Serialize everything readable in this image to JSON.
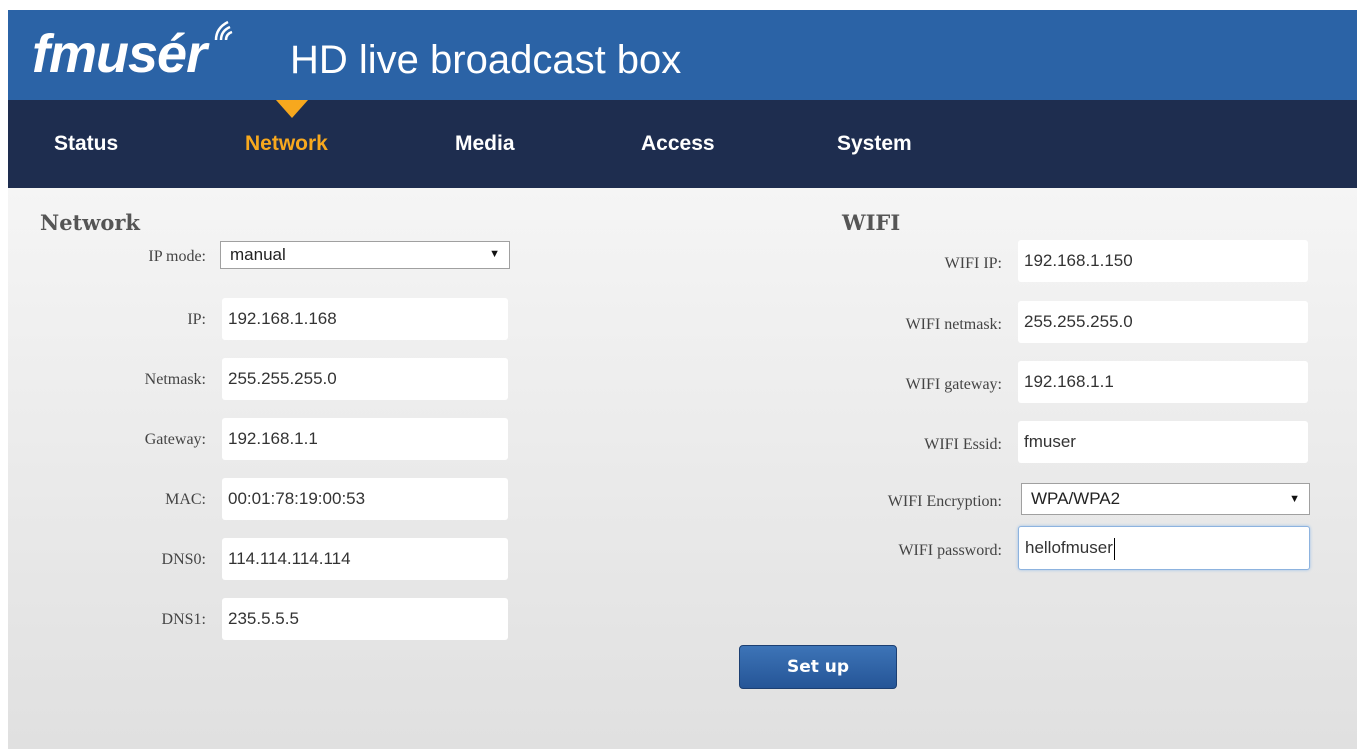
{
  "header": {
    "logo_text": "fmusér",
    "product_title": "HD live broadcast box"
  },
  "nav": {
    "items": [
      {
        "label": "Status"
      },
      {
        "label": "Network",
        "active": true
      },
      {
        "label": "Media"
      },
      {
        "label": "Access"
      },
      {
        "label": "System"
      }
    ]
  },
  "network": {
    "title": "Network",
    "ip_mode": {
      "label": "IP mode:",
      "value": "manual"
    },
    "ip": {
      "label": "IP:",
      "value": "192.168.1.168"
    },
    "netmask": {
      "label": "Netmask:",
      "value": "255.255.255.0"
    },
    "gateway": {
      "label": "Gateway:",
      "value": "192.168.1.1"
    },
    "mac": {
      "label": "MAC:",
      "value": "00:01:78:19:00:53"
    },
    "dns0": {
      "label": "DNS0:",
      "value": "114.114.114.114"
    },
    "dns1": {
      "label": "DNS1:",
      "value": "235.5.5.5"
    }
  },
  "wifi": {
    "title": "WIFI",
    "ip": {
      "label": "WIFI IP:",
      "value": "192.168.1.150"
    },
    "netmask": {
      "label": "WIFI netmask:",
      "value": "255.255.255.0"
    },
    "gateway": {
      "label": "WIFI gateway:",
      "value": "192.168.1.1"
    },
    "essid": {
      "label": "WIFI Essid:",
      "value": "fmuser"
    },
    "encryption": {
      "label": "WIFI Encryption:",
      "value": "WPA/WPA2"
    },
    "password": {
      "label": "WIFI password:",
      "value": "hellofmuser"
    }
  },
  "actions": {
    "setup_label": "Set up"
  },
  "colors": {
    "header_blue": "#2b63a6",
    "nav_navy": "#1e2d4f",
    "active_orange": "#f7a81e"
  },
  "icons": {
    "wifi_mark": "wifi-signal-icon",
    "select_arrow": "dropdown-arrow-icon"
  }
}
